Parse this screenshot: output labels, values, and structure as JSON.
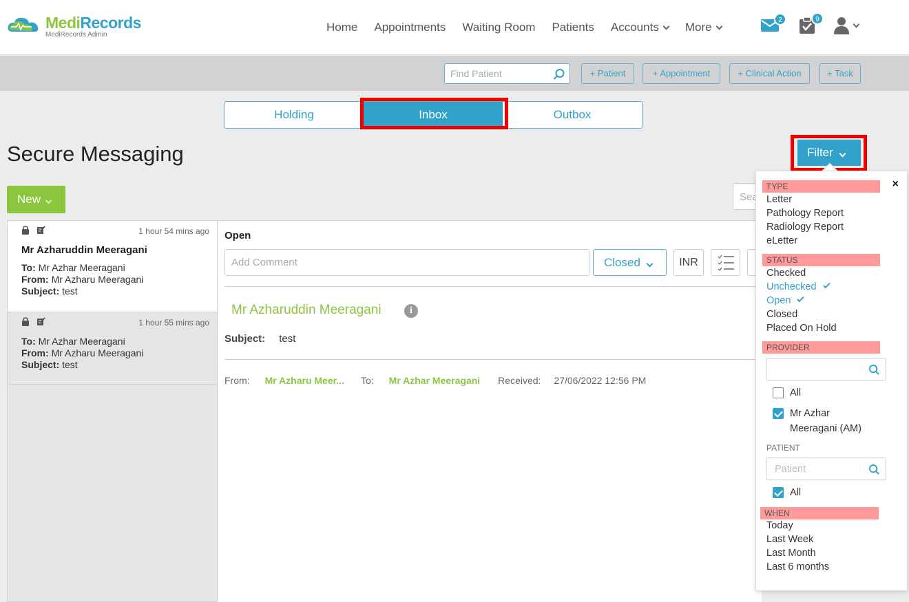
{
  "brand": {
    "name_part1": "Medi",
    "name_part2": "Records",
    "subtitle": "MediRecords Admin",
    "color_green": "#8cc63e",
    "color_blue": "#31a2c9"
  },
  "nav": {
    "items": [
      {
        "label": "Home",
        "has_dropdown": false
      },
      {
        "label": "Appointments",
        "has_dropdown": false
      },
      {
        "label": "Waiting Room",
        "has_dropdown": false
      },
      {
        "label": "Patients",
        "has_dropdown": false
      },
      {
        "label": "Accounts",
        "has_dropdown": true
      },
      {
        "label": "More",
        "has_dropdown": true
      }
    ],
    "mail_badge": "2",
    "tasks_badge": "9",
    "icons": [
      "mail-icon",
      "tasks-icon",
      "user-icon"
    ]
  },
  "toolbar": {
    "find_placeholder": "Find Patient",
    "add_patient": "+ Patient",
    "add_appointment": "+ Appointment",
    "add_clinical_action": "+ Clinical Action",
    "add_task": "+ Task"
  },
  "tabs": [
    {
      "label": "Holding",
      "active": false
    },
    {
      "label": "Inbox",
      "active": true
    },
    {
      "label": "Outbox",
      "active": false
    }
  ],
  "page": {
    "title": "Secure Messaging",
    "filter_label": "Filter",
    "new_label": "New",
    "search_peek": "Sea"
  },
  "messages": [
    {
      "time": "1 hour 54 mins ago",
      "name": "Mr Azharuddin Meeragani",
      "to_label": "To:",
      "to": "Mr Azhar Meeragani",
      "from_label": "From:",
      "from": "Mr Azharu Meeragani",
      "subject_label": "Subject:",
      "subject": "test"
    },
    {
      "time": "1 hour 55 mins ago",
      "to_label": "To:",
      "to": "Mr Azhar Meeragani",
      "from_label": "From:",
      "from": "Mr Azharu Meeragani",
      "subject_label": "Subject:",
      "subject": "test"
    }
  ],
  "detail": {
    "status": "Open",
    "comment_placeholder": "Add Comment",
    "closed_label": "Closed",
    "inr_label": "INR",
    "sender": "Mr Azharuddin Meeragani",
    "subject_label": "Subject:",
    "subject": "test",
    "from_label": "From:",
    "from": "Mr Azharu Meer...",
    "to_label": "To:",
    "to": "Mr Azhar Meeragani",
    "received_label": "Received:",
    "received": "27/06/2022 12:56 PM"
  },
  "filter_panel": {
    "close": "×",
    "type_heading": "TYPE",
    "types": [
      "Letter",
      "Pathology Report",
      "Radiology Report",
      "eLetter"
    ],
    "status_heading": "STATUS",
    "statuses": [
      {
        "label": "Checked",
        "selected": false
      },
      {
        "label": "Unchecked",
        "selected": true
      },
      {
        "label": "Open",
        "selected": true
      },
      {
        "label": "Closed",
        "selected": false
      },
      {
        "label": "Placed On Hold",
        "selected": false
      }
    ],
    "provider_heading": "PROVIDER",
    "provider_all": "All",
    "provider_all_checked": false,
    "provider_name_line1": "Mr Azhar",
    "provider_name_line2": "Meeragani (AM)",
    "provider_checked": true,
    "patient_label": "PATIENT",
    "patient_placeholder": "Patient",
    "patient_all": "All",
    "patient_all_checked": true,
    "when_heading": "WHEN",
    "when": [
      "Today",
      "Last Week",
      "Last Month",
      "Last 6 months"
    ]
  }
}
